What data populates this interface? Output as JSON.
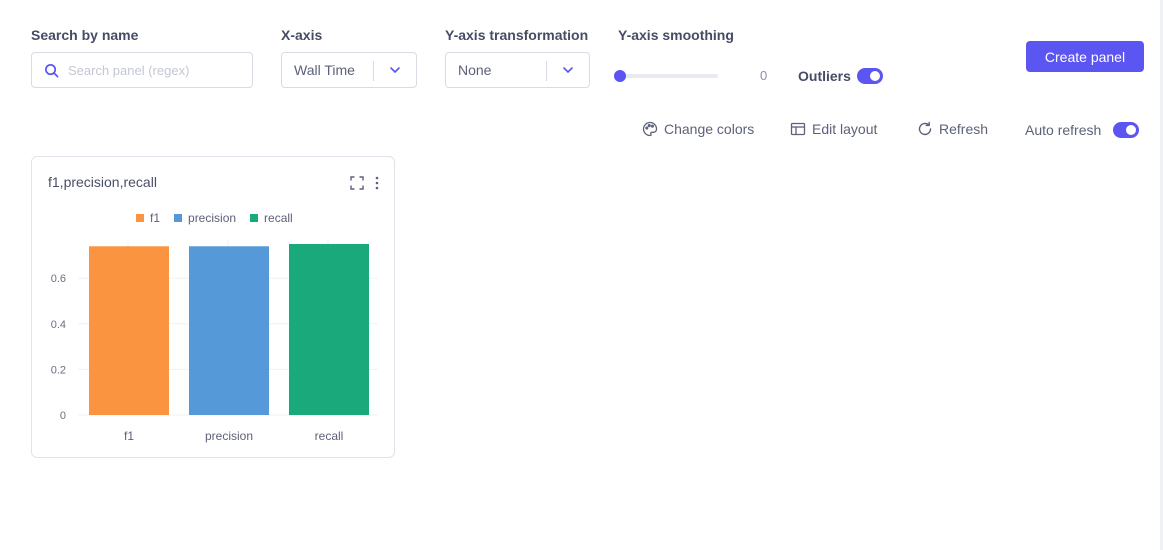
{
  "controls": {
    "search": {
      "label": "Search by name",
      "placeholder": "Search panel (regex)",
      "value": ""
    },
    "xaxis": {
      "label": "X-axis",
      "value": "Wall Time"
    },
    "ytransform": {
      "label": "Y-axis transformation",
      "value": "None"
    },
    "smoothing": {
      "label": "Y-axis smoothing",
      "value": "0",
      "level": 0
    },
    "outliers": {
      "label": "Outliers",
      "enabled": true
    },
    "create_panel_label": "Create panel"
  },
  "actions": {
    "change_colors": "Change colors",
    "edit_layout": "Edit layout",
    "refresh": "Refresh",
    "auto_refresh": "Auto refresh",
    "auto_refresh_enabled": true
  },
  "panel": {
    "title": "f1,precision,recall",
    "icons": [
      "expand-icon",
      "more-vertical-icon"
    ]
  },
  "colors": {
    "accent": "#5b55f1",
    "f1": "#fb9441",
    "precision": "#5599d8",
    "recall": "#1aa97a"
  },
  "chart_data": {
    "type": "bar",
    "categories": [
      "f1",
      "precision",
      "recall"
    ],
    "series": [
      {
        "name": "f1",
        "values": [
          0.74
        ]
      },
      {
        "name": "precision",
        "values": [
          0.74
        ]
      },
      {
        "name": "recall",
        "values": [
          0.75
        ]
      }
    ],
    "values": [
      0.74,
      0.74,
      0.75
    ],
    "yticks": [
      "0",
      "0.2",
      "0.4",
      "0.6"
    ],
    "ylim": [
      0,
      0.76
    ],
    "legend": [
      "f1",
      "precision",
      "recall"
    ],
    "legend_position": "top",
    "grid": true
  }
}
